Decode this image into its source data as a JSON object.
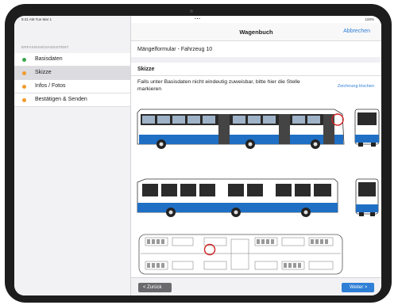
{
  "status": {
    "time": "9:41 AM  Tue Mar 1",
    "center": "•••",
    "battery": "100%"
  },
  "sidebar": {
    "section_title": "ERFASSUNGSASSISTENT",
    "items": [
      {
        "label": "Basisdaten",
        "color": "#3aa64a",
        "active": false
      },
      {
        "label": "Skizze",
        "color": "#f39a2b",
        "active": true
      },
      {
        "label": "Infos / Fotos",
        "color": "#f39a2b",
        "active": false
      },
      {
        "label": "Bestätigen & Senden",
        "color": "#f39a2b",
        "active": false
      }
    ]
  },
  "navbar": {
    "title": "Wagenbuch",
    "cancel": "Abbrechen"
  },
  "form": {
    "title": "Mängelformular - Fahrzeug 10",
    "section": "Skizze",
    "hint": "Falls unter Basisdaten nicht eindeutig zuweisbar, bitte hier die Stelle markieren",
    "clear_drawing": "Zeichnung löschen"
  },
  "footer": {
    "back": "< Zurück",
    "next": "Weiter >"
  },
  "colors": {
    "accent": "#2f7fd6",
    "bus_blue": "#1f6fc4",
    "marker_red": "#d02020"
  }
}
